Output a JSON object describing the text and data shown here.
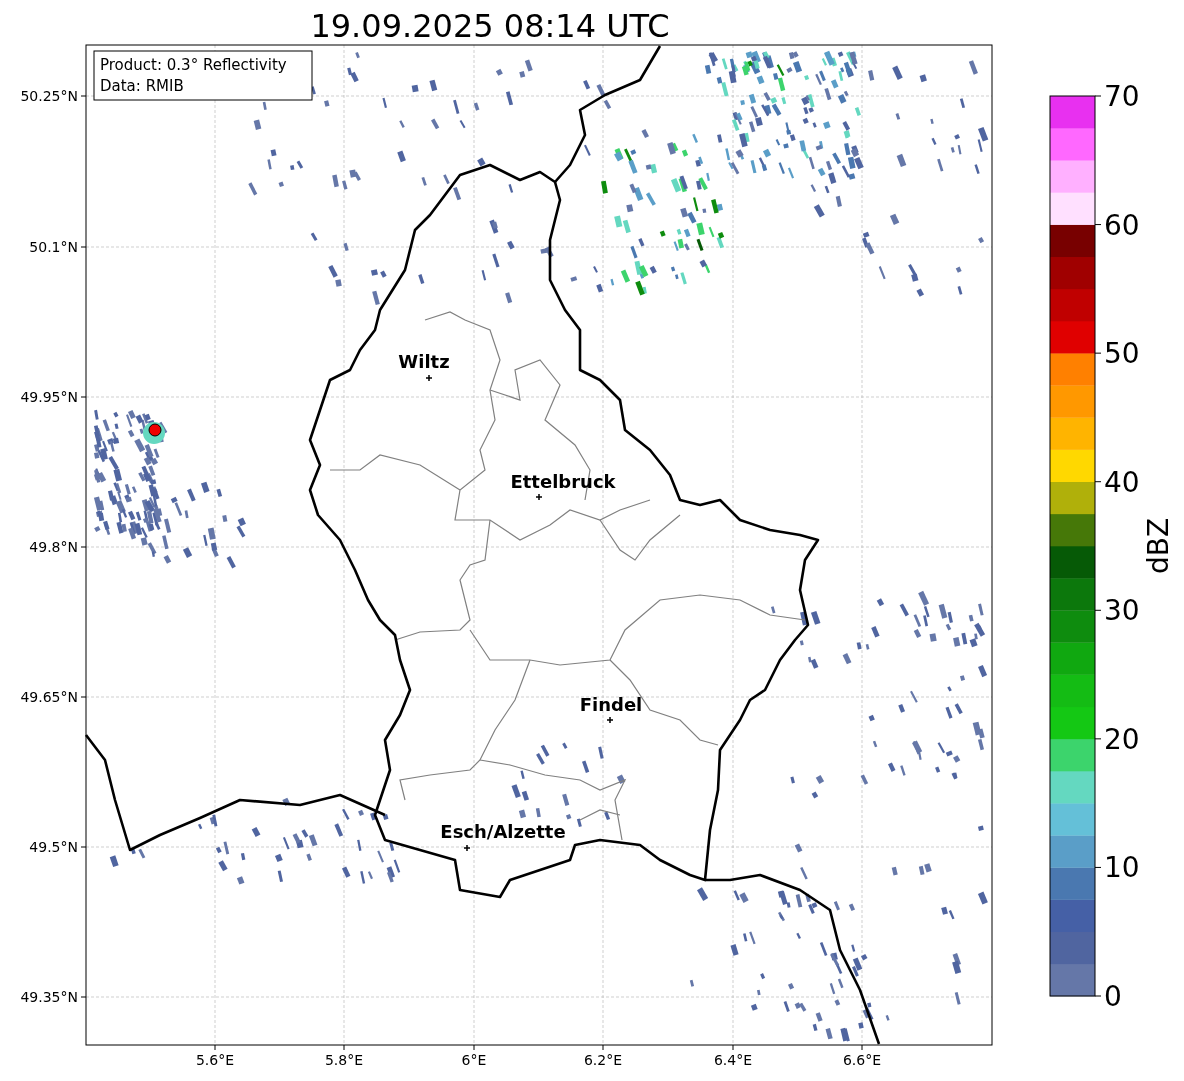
{
  "title": "19.09.2025 08:14 UTC",
  "info_box": {
    "lines": [
      "Product: 0.3° Reflectivity",
      "Data: RMIB"
    ]
  },
  "map": {
    "x_ticks": [
      "5.6°E",
      "5.8°E",
      "6°E",
      "6.2°E",
      "6.4°E",
      "6.6°E"
    ],
    "y_ticks": [
      "50.25°N",
      "50.1°N",
      "49.95°N",
      "49.8°N",
      "49.65°N",
      "49.5°N",
      "49.35°N"
    ],
    "cities": [
      {
        "name": "Wiltz"
      },
      {
        "name": "Ettelbruck"
      },
      {
        "name": "Findel"
      },
      {
        "name": "Esch/Alzette"
      }
    ]
  },
  "colorbar": {
    "label": "dBZ",
    "ticks": [
      "70",
      "60",
      "50",
      "40",
      "30",
      "20",
      "10",
      "0"
    ],
    "segments": [
      {
        "color": "#6577a8"
      },
      {
        "color": "#5065a0"
      },
      {
        "color": "#4560a6"
      },
      {
        "color": "#4a78b0"
      },
      {
        "color": "#5a9ec8"
      },
      {
        "color": "#64c0d8"
      },
      {
        "color": "#64d8c0"
      },
      {
        "color": "#3cd46c"
      },
      {
        "color": "#14c814"
      },
      {
        "color": "#14bc14"
      },
      {
        "color": "#10a810"
      },
      {
        "color": "#0e8c0e"
      },
      {
        "color": "#0c780c"
      },
      {
        "color": "#065a06"
      },
      {
        "color": "#467808"
      },
      {
        "color": "#b0b00a"
      },
      {
        "color": "#ffd800"
      },
      {
        "color": "#ffb400"
      },
      {
        "color": "#ff9800"
      },
      {
        "color": "#ff8000"
      },
      {
        "color": "#e00000"
      },
      {
        "color": "#c00000"
      },
      {
        "color": "#a00000"
      },
      {
        "color": "#780000"
      },
      {
        "color": "#ffe0ff"
      },
      {
        "color": "#ffb0ff"
      },
      {
        "color": "#ff68ff"
      },
      {
        "color": "#e830f0"
      }
    ]
  }
}
